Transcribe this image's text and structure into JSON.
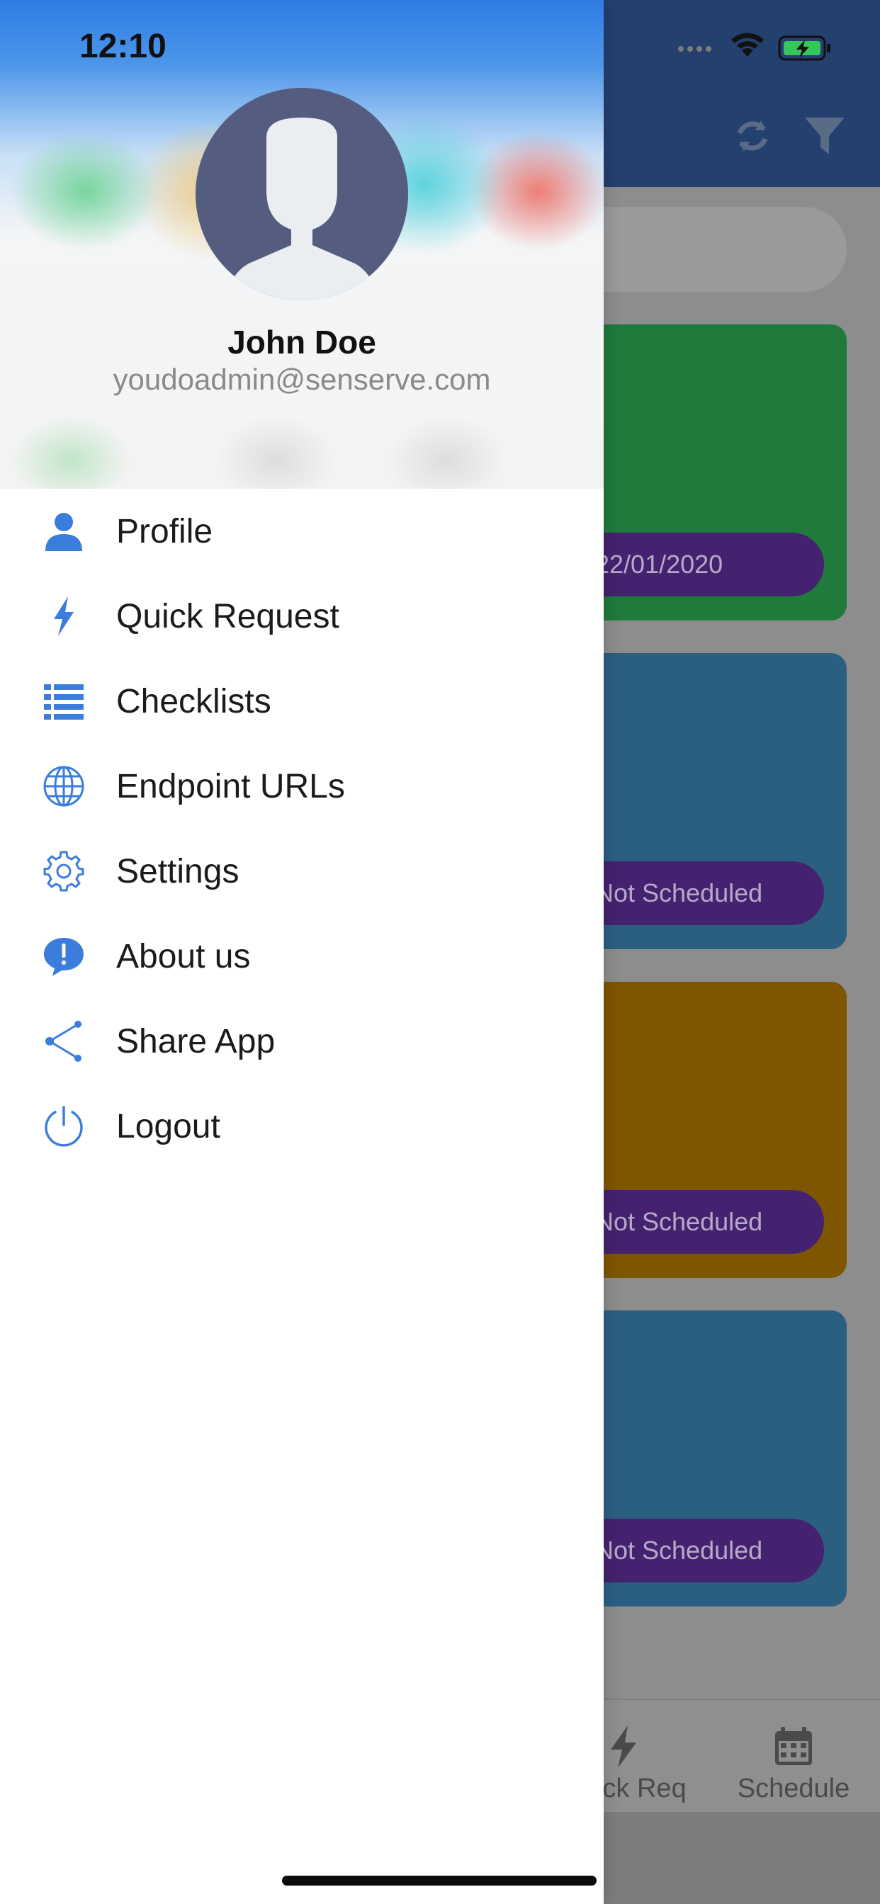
{
  "status_bar": {
    "time": "12:10"
  },
  "user": {
    "name": "John Doe",
    "email": "youdoadmin@senserve.com"
  },
  "menu": [
    {
      "label": "Profile",
      "icon": "person-icon"
    },
    {
      "label": "Quick Request",
      "icon": "bolt-icon"
    },
    {
      "label": "Checklists",
      "icon": "list-icon"
    },
    {
      "label": "Endpoint URLs",
      "icon": "globe-icon"
    },
    {
      "label": "Settings",
      "icon": "gear-icon"
    },
    {
      "label": "About us",
      "icon": "info-bubble-icon"
    },
    {
      "label": "Share App",
      "icon": "share-icon"
    },
    {
      "label": "Logout",
      "icon": "power-icon"
    }
  ],
  "background": {
    "cards": [
      {
        "color": "#1f7a3b",
        "pill_text": "22/01/2020"
      },
      {
        "color": "#2b5f80",
        "pill_text": "Not Scheduled"
      },
      {
        "color": "#7e5600",
        "pill_text": "Not Scheduled"
      },
      {
        "color": "#2b5f80",
        "pill_text": "Not Scheduled"
      }
    ],
    "tabs": [
      {
        "label": "Quick Req",
        "icon": "bolt-icon"
      },
      {
        "label": "Schedule",
        "icon": "calendar-icon"
      }
    ]
  },
  "colors": {
    "accent": "#3b7ddd",
    "nav": "#24406f",
    "pill": "#44226f"
  }
}
